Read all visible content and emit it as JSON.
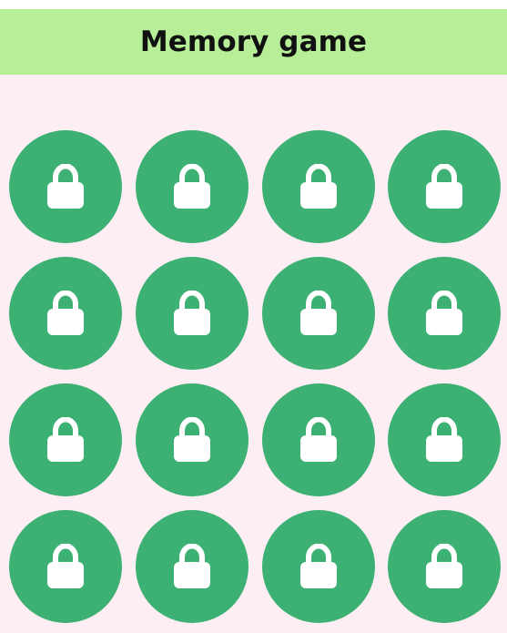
{
  "header": {
    "title": "Memory game"
  },
  "colors": {
    "header_bg": "#b6ef98",
    "board_bg": "#fdeef4",
    "tile_bg": "#3cb173",
    "icon_fill": "#ffffff",
    "title_text": "#111111"
  },
  "board": {
    "tiles": [
      {
        "row": 1,
        "col": 1,
        "state": "locked",
        "icon": "lock-icon"
      },
      {
        "row": 1,
        "col": 2,
        "state": "locked",
        "icon": "lock-icon"
      },
      {
        "row": 1,
        "col": 3,
        "state": "locked",
        "icon": "lock-icon"
      },
      {
        "row": 1,
        "col": 4,
        "state": "locked",
        "icon": "lock-icon"
      },
      {
        "row": 2,
        "col": 1,
        "state": "locked",
        "icon": "lock-icon"
      },
      {
        "row": 2,
        "col": 2,
        "state": "locked",
        "icon": "lock-icon"
      },
      {
        "row": 2,
        "col": 3,
        "state": "locked",
        "icon": "lock-icon"
      },
      {
        "row": 2,
        "col": 4,
        "state": "locked",
        "icon": "lock-icon"
      },
      {
        "row": 3,
        "col": 1,
        "state": "locked",
        "icon": "lock-icon"
      },
      {
        "row": 3,
        "col": 2,
        "state": "locked",
        "icon": "lock-icon"
      },
      {
        "row": 3,
        "col": 3,
        "state": "locked",
        "icon": "lock-icon"
      },
      {
        "row": 3,
        "col": 4,
        "state": "locked",
        "icon": "lock-icon"
      },
      {
        "row": 4,
        "col": 1,
        "state": "locked",
        "icon": "lock-icon"
      },
      {
        "row": 4,
        "col": 2,
        "state": "locked",
        "icon": "lock-icon"
      },
      {
        "row": 4,
        "col": 3,
        "state": "locked",
        "icon": "lock-icon"
      },
      {
        "row": 4,
        "col": 4,
        "state": "locked",
        "icon": "lock-icon"
      }
    ]
  }
}
